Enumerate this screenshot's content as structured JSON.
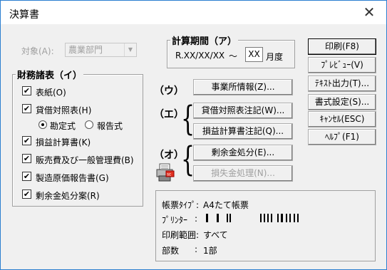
{
  "window": {
    "title": "決算書",
    "close_glyph": "✕"
  },
  "target": {
    "label": "対象(A):",
    "value": "農業部門"
  },
  "period": {
    "title": "計算期間（ア）",
    "from": "R.XX/XX/XX",
    "tilde": "～",
    "month_value": "XX",
    "month_label": "月度"
  },
  "statements": {
    "title": "財務諸表（イ）",
    "items": [
      {
        "label": "表紙(O)",
        "checked": true
      },
      {
        "label": "貸借対照表(H)",
        "checked": true
      },
      {
        "label": "損益計算書(K)",
        "checked": true
      },
      {
        "label": "販売費及び一般管理費(B)",
        "checked": true
      },
      {
        "label": "製造原価報告書(G)",
        "checked": true
      },
      {
        "label": "剰余金処分案(R)",
        "checked": true
      }
    ],
    "radios": [
      {
        "label": "勘定式",
        "selected": true
      },
      {
        "label": "報告式",
        "selected": false
      }
    ]
  },
  "markers": {
    "u": "（ウ）",
    "e": "（エ）",
    "o": "（オ）"
  },
  "mid_buttons": {
    "office": "事業所情報(Z)...",
    "bs_notes": "貸借対照表注記(W)...",
    "pl_notes": "損益計算書注記(Q)...",
    "surplus": "剰余金処分(E)...",
    "loss": "損失金処理(N)..."
  },
  "right_buttons": {
    "print": "印刷(F8)",
    "preview": "ﾌﾟﾚﾋﾞｭｰ(V)",
    "text_out": "ﾃｷｽﾄ出力(T)...",
    "format": "書式設定(S)...",
    "cancel": "ｷｬﾝｾﾙ(ESC)",
    "help": "ﾍﾙﾌﾟ(F1)"
  },
  "info": {
    "form_type_label": "帳票ﾀｲﾌﾟ:",
    "form_type_value": "A4たて帳票",
    "printer_label": "ﾌﾟﾘﾝﾀｰ",
    "printer_colon": ":",
    "range_label": "印刷範囲:",
    "range_value": "すべて",
    "copies_label": "部数",
    "copies_colon": ":",
    "copies_value": "1部"
  },
  "icons": {
    "printer": "printer-icon"
  },
  "colors": {
    "border_accent": "#2b7fd0",
    "disabled": "#a0a0a0",
    "dialog_bg": "#f0f0f0"
  }
}
